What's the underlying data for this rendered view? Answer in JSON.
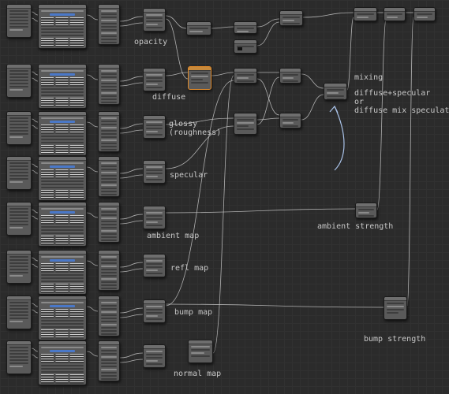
{
  "canvas": {
    "background": "#2b2b2b",
    "grid_color": "#313131",
    "wire_color": "#c8c8c8",
    "node_color": "#5a5a5a",
    "selected_color": "#e08a2a",
    "arrow_color": "#a9c2e8"
  },
  "labels": {
    "opacity": "opacity",
    "diffuse": "diffuse",
    "glossy": "glossy\n(roughness)",
    "specular": "specular",
    "ambient_map": "ambient map",
    "refl_map": "refl map",
    "bump_map": "bump map",
    "normal_map": "normal map",
    "mixing": "mixing",
    "mixing_note": "diffuse+specular\nor\ndiffuse mix speculat",
    "ambient_strength": "ambient strength",
    "bump_strength": "bump strength"
  },
  "texture_rows": [
    {
      "name": "opacity"
    },
    {
      "name": "diffuse"
    },
    {
      "name": "glossy"
    },
    {
      "name": "specular"
    },
    {
      "name": "ambient-map"
    },
    {
      "name": "refl-map"
    },
    {
      "name": "bump-map"
    },
    {
      "name": "normal-map"
    }
  ],
  "icons": {
    "annotation_arrow": "curved-arrow-icon"
  }
}
